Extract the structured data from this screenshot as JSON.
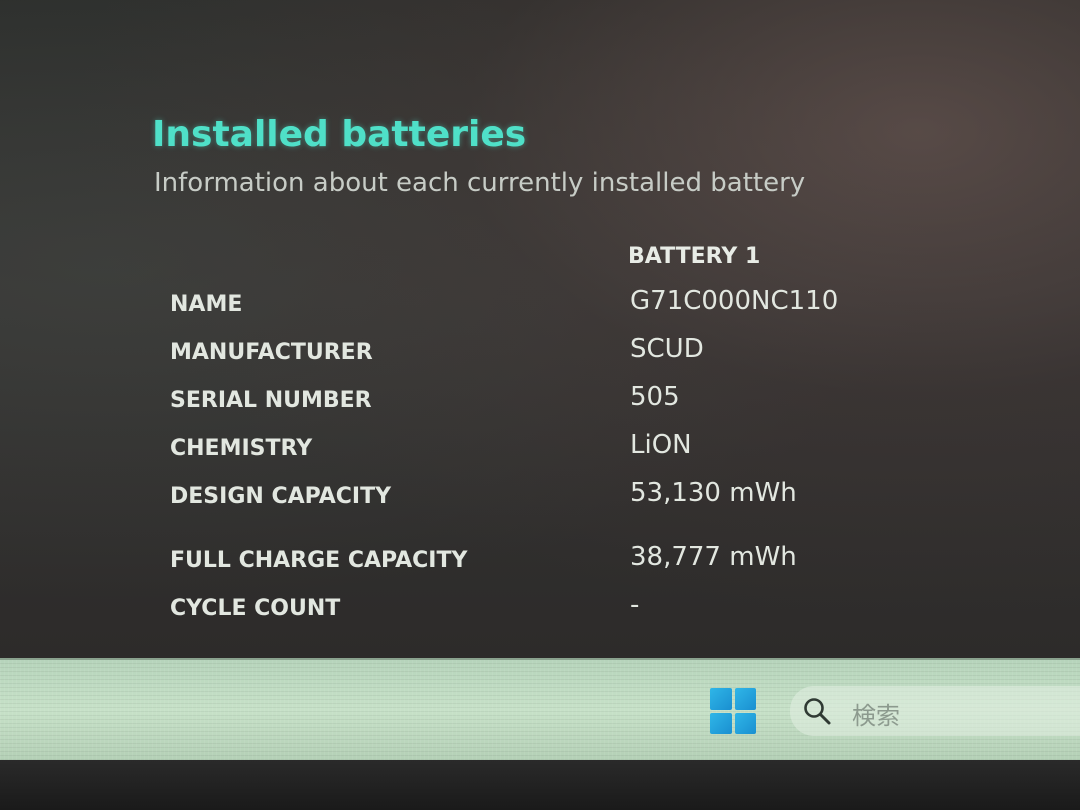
{
  "report": {
    "title": "Installed batteries",
    "subtitle": "Information about each currently installed battery"
  },
  "table": {
    "column_header": "BATTERY 1",
    "rows": [
      {
        "label": "NAME",
        "value": "G71C000NC110"
      },
      {
        "label": "MANUFACTURER",
        "value": "SCUD"
      },
      {
        "label": "SERIAL NUMBER",
        "value": "505"
      },
      {
        "label": "CHEMISTRY",
        "value": "LiON"
      },
      {
        "label": "DESIGN CAPACITY",
        "value": "53,130 mWh"
      },
      {
        "label": "FULL CHARGE CAPACITY",
        "value": "38,777 mWh"
      },
      {
        "label": "CYCLE COUNT",
        "value": "-"
      }
    ]
  },
  "taskbar": {
    "search_placeholder": "検索",
    "start_icon": "windows-logo-icon",
    "search_icon": "search-icon"
  },
  "colors": {
    "title": "#4fe0c8",
    "text": "#e2e7e0",
    "taskbar": "#c7e1c8",
    "windows_accent": "#1a8fd0"
  }
}
